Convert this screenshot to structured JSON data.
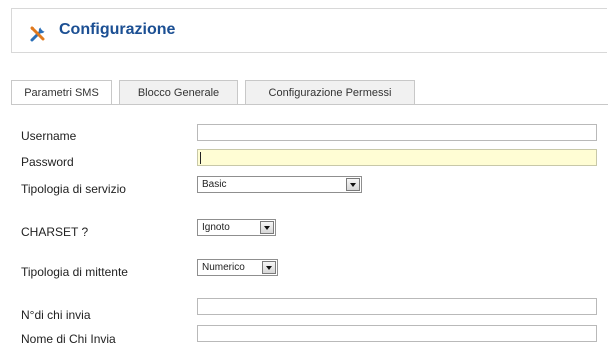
{
  "header": {
    "title": "Configurazione",
    "icon": "tools-icon"
  },
  "tabs": [
    {
      "label": "Parametri SMS",
      "active": true
    },
    {
      "label": "Blocco Generale",
      "active": false
    },
    {
      "label": "Configurazione Permessi",
      "active": false
    }
  ],
  "form": {
    "username": {
      "label": "Username",
      "value": ""
    },
    "password": {
      "label": "Password",
      "value": ""
    },
    "service_type": {
      "label": "Tipologia di servizio",
      "selected": "Basic"
    },
    "charset": {
      "label": "CHARSET ?",
      "selected": "Ignoto"
    },
    "sender_type": {
      "label": "Tipologia di mittente",
      "selected": "Numerico"
    },
    "sender_number": {
      "label": "N°di chi invia",
      "value": ""
    },
    "sender_name": {
      "label": "Nome di Chi Invia",
      "value": ""
    }
  },
  "colors": {
    "title": "#1b4f93",
    "focused_field": "#fffdd4"
  }
}
